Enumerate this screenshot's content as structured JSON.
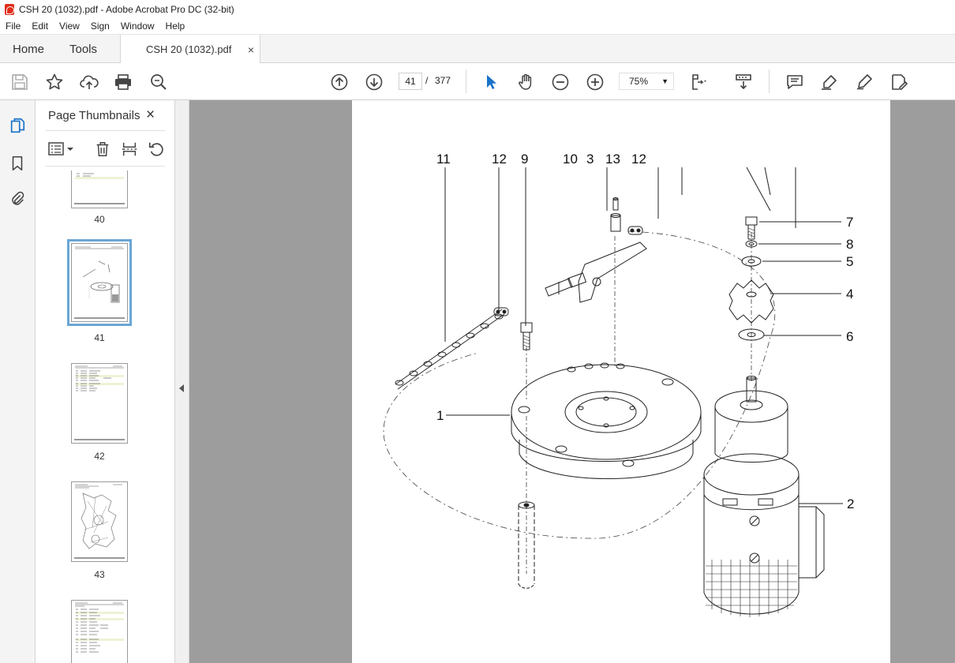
{
  "window": {
    "title": "CSH 20 (1032).pdf - Adobe Acrobat Pro DC (32-bit)"
  },
  "menu": [
    "File",
    "Edit",
    "View",
    "Sign",
    "Window",
    "Help"
  ],
  "tabs": {
    "home": "Home",
    "tools": "Tools",
    "document": "CSH 20 (1032).pdf",
    "close": "×"
  },
  "toolbar": {
    "current_page": "41",
    "separator": "/",
    "total_pages": "377",
    "zoom": "75%",
    "icons": [
      "save-icon",
      "star-icon",
      "upload-icon",
      "print-icon",
      "find-icon",
      "prev-page-icon",
      "next-page-icon",
      "select-arrow-icon",
      "hand-icon",
      "zoom-out-icon",
      "zoom-in-icon",
      "page-fit-icon",
      "scroll-mode-icon",
      "comment-icon",
      "highlight-icon",
      "sign-icon",
      "edit-pdf-icon"
    ]
  },
  "left_rail": {
    "icons": [
      "copy-pages-icon",
      "bookmark-icon",
      "attachment-icon"
    ]
  },
  "thumbnails_panel": {
    "title": "Page Thumbnails",
    "close": "×",
    "pages": [
      {
        "number": "40",
        "selected": false
      },
      {
        "number": "41",
        "selected": true
      },
      {
        "number": "42",
        "selected": false
      },
      {
        "number": "43",
        "selected": false
      }
    ]
  },
  "drawing": {
    "callouts": [
      "11",
      "12",
      "9",
      "10",
      "3",
      "13",
      "12",
      "7",
      "8",
      "5",
      "4",
      "6",
      "1",
      "2"
    ]
  },
  "colors": {
    "accent_blue": "#1a73c8",
    "viewer_bg": "#9d9d9d",
    "thumb_selection": "#6aa6d6"
  }
}
